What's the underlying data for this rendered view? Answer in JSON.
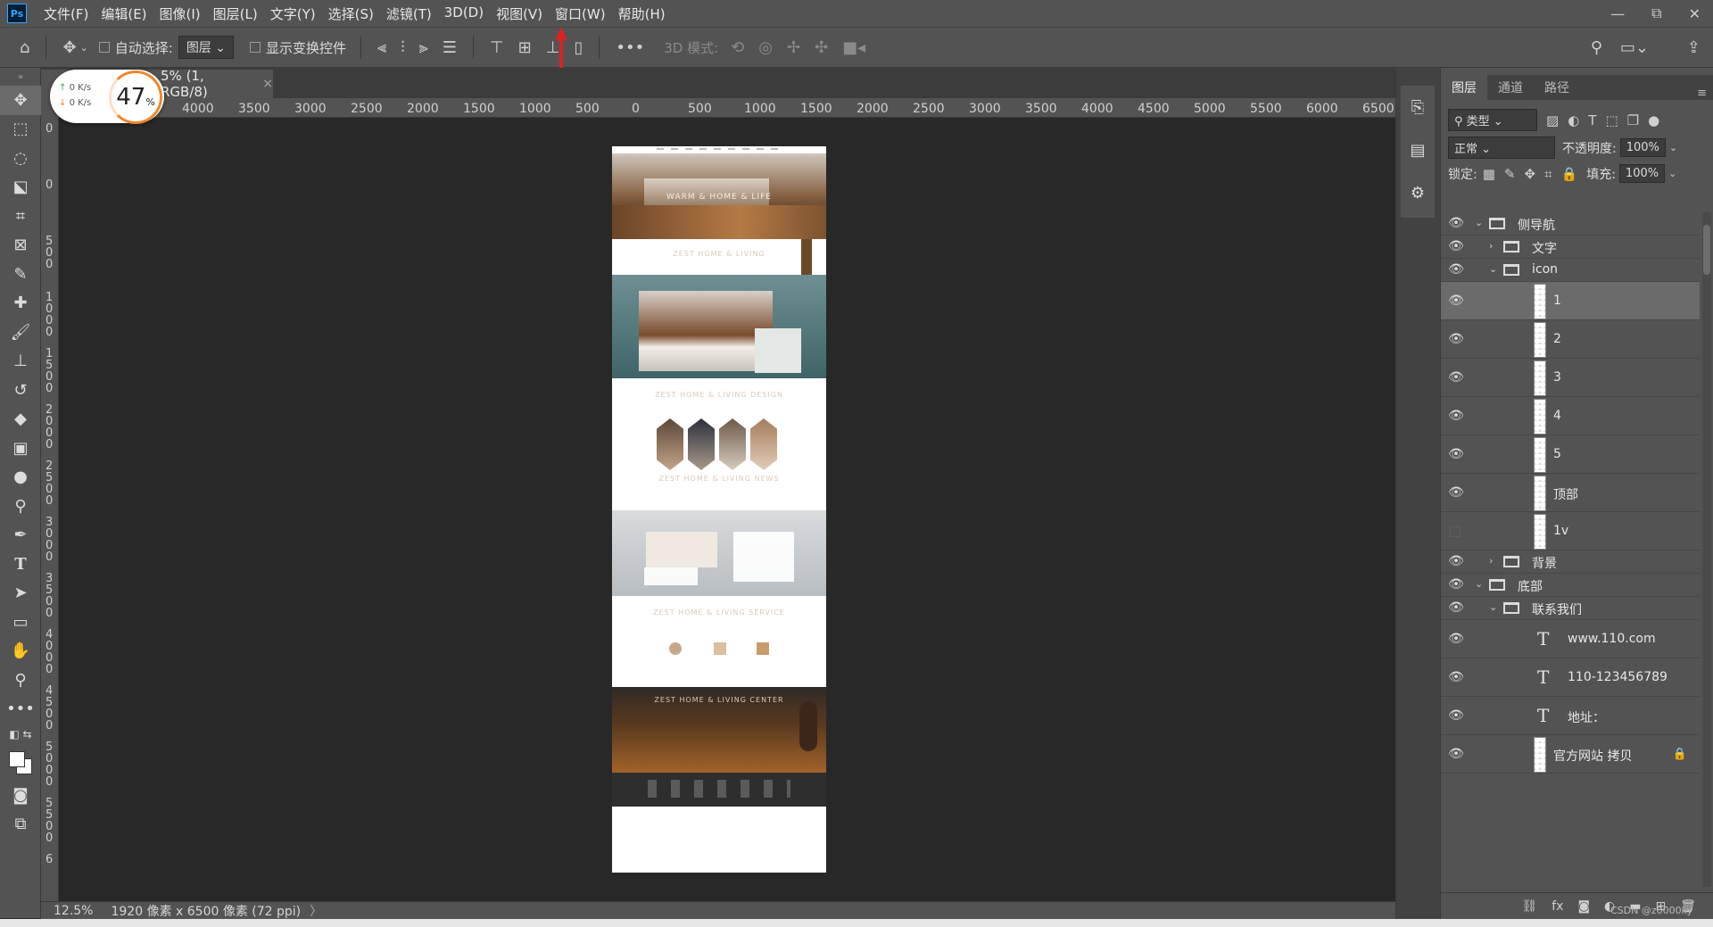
{
  "app": {
    "logo": "Ps"
  },
  "menu": [
    "文件(F)",
    "编辑(E)",
    "图像(I)",
    "图层(L)",
    "文字(Y)",
    "选择(S)",
    "滤镜(T)",
    "3D(D)",
    "视图(V)",
    "窗口(W)",
    "帮助(H)"
  ],
  "window_controls": {
    "minimize": "—",
    "restore": "⧉",
    "close": "✕"
  },
  "options": {
    "auto_select_label": "自动选择:",
    "auto_select_value": "图层",
    "show_transform_label": "显示变换控件",
    "mode_3d_label": "3D 模式:",
    "more": "•••"
  },
  "document_tab": {
    "title": "5% (1, RGB/8)",
    "close": "×"
  },
  "net_widget": {
    "up": "0  K/s",
    "down": "0  K/s",
    "percent": "47",
    "percent_sign": "%"
  },
  "ruler_h": [
    "4000",
    "3500",
    "3000",
    "2500",
    "2000",
    "1500",
    "1000",
    "500",
    "0",
    "500",
    "1000",
    "1500",
    "2000",
    "2500",
    "3000",
    "3500",
    "4000",
    "4500",
    "5000",
    "5500",
    "6000",
    "6500"
  ],
  "ruler_v": [
    "0",
    "0",
    "500",
    "1000",
    "1500",
    "2000",
    "2500",
    "3000",
    "3500",
    "4000",
    "4500",
    "5000",
    "5500",
    "6"
  ],
  "document_preview": {
    "hero_text": "WARM & HOME & LIFE",
    "s1": "ZEST HOME & LIVING",
    "s2": "ZEST HOME & LIVING DESIGN",
    "s3": "ZEST HOME & LIVING NEWS",
    "s4": "ZEST HOME & LIVING SERVICE",
    "s5": "ZEST HOME & LIVING CENTER"
  },
  "status": {
    "zoom": "12.5%",
    "info": "1920 像素 x 6500 像素 (72 ppi)",
    "more": "〉"
  },
  "layers_panel": {
    "tabs": [
      "图层",
      "通道",
      "路径"
    ],
    "filter_label": "类型",
    "blend_mode": "正常",
    "opacity_label": "不透明度:",
    "opacity_value": "100%",
    "lock_label": "锁定:",
    "fill_label": "填充:",
    "fill_value": "100%",
    "layers": [
      {
        "name": "侧导航",
        "kind": "group",
        "open": true,
        "indent": 0,
        "visible": true
      },
      {
        "name": "文字",
        "kind": "group",
        "open": false,
        "indent": 1,
        "visible": true
      },
      {
        "name": "icon",
        "kind": "group",
        "open": true,
        "indent": 1,
        "visible": true
      },
      {
        "name": "1",
        "kind": "image",
        "indent": 2,
        "visible": true,
        "selected": true
      },
      {
        "name": "2",
        "kind": "image",
        "indent": 2,
        "visible": true
      },
      {
        "name": "3",
        "kind": "image",
        "indent": 2,
        "visible": true
      },
      {
        "name": "4",
        "kind": "image",
        "indent": 2,
        "visible": true
      },
      {
        "name": "5",
        "kind": "image",
        "indent": 2,
        "visible": true
      },
      {
        "name": "顶部",
        "kind": "image",
        "indent": 2,
        "visible": true
      },
      {
        "name": "1v",
        "kind": "image",
        "indent": 2,
        "visible": false
      },
      {
        "name": "背景",
        "kind": "group",
        "open": false,
        "indent": 1,
        "visible": true
      },
      {
        "name": "底部",
        "kind": "group",
        "open": true,
        "indent": 0,
        "visible": true
      },
      {
        "name": "联系我们",
        "kind": "group",
        "open": true,
        "indent": 1,
        "visible": true
      },
      {
        "name": "www.110.com",
        "kind": "text",
        "indent": 2,
        "visible": true
      },
      {
        "name": "110-123456789",
        "kind": "text",
        "indent": 2,
        "visible": true
      },
      {
        "name": "地址：",
        "kind": "text",
        "indent": 2,
        "visible": true
      },
      {
        "name": "官方网站 拷贝",
        "kind": "image",
        "indent": 2,
        "visible": true,
        "locked": true
      }
    ],
    "watermark": "CSDN @z0000ky"
  }
}
